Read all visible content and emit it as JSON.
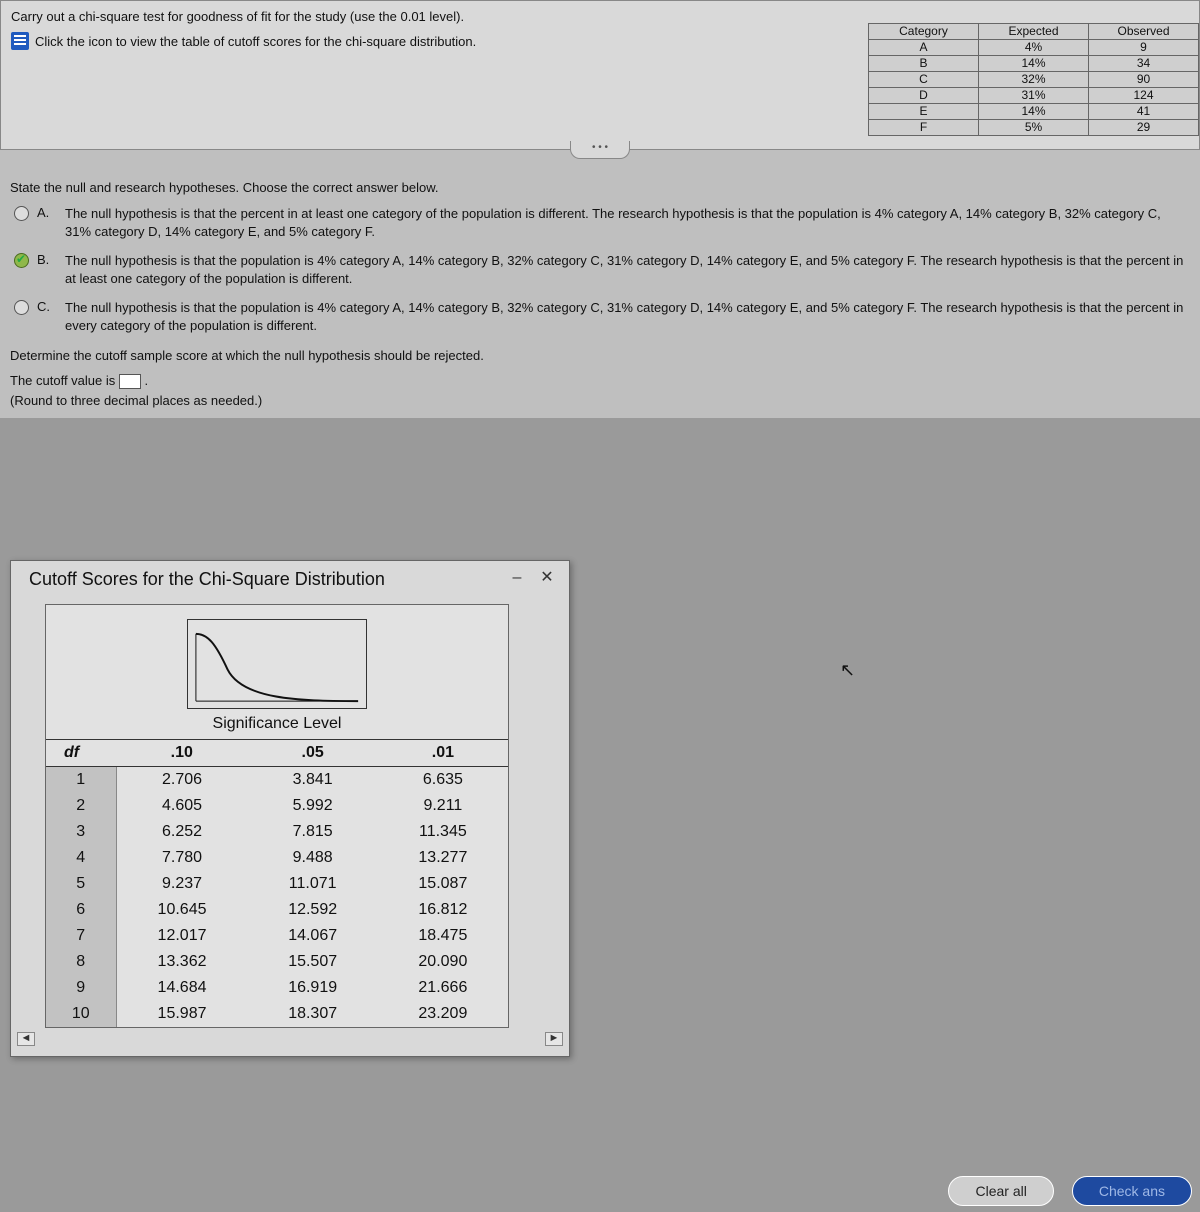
{
  "top": {
    "instruction": "Carry out a chi-square test for goodness of fit for the study (use the 0.01 level).",
    "link_text": "Click the icon to view the table of cutoff scores for the chi-square distribution.",
    "collapse": "• • •"
  },
  "dataTable": {
    "headers": [
      "Category",
      "Expected",
      "Observed"
    ],
    "rows": [
      [
        "A",
        "4%",
        "9"
      ],
      [
        "B",
        "14%",
        "34"
      ],
      [
        "C",
        "32%",
        "90"
      ],
      [
        "D",
        "31%",
        "124"
      ],
      [
        "E",
        "14%",
        "41"
      ],
      [
        "F",
        "5%",
        "29"
      ]
    ]
  },
  "question": {
    "prompt": "State the null and research hypotheses. Choose the correct answer below.",
    "options": [
      {
        "letter": "A.",
        "selected": false,
        "text": "The null hypothesis is that the percent in at least one category of the population is different. The research hypothesis is that the population is 4% category A, 14% category B, 32% category C, 31% category D, 14% category E, and 5% category F."
      },
      {
        "letter": "B.",
        "selected": true,
        "text": "The null hypothesis is that the population is 4% category A, 14% category B, 32% category C, 31% category D, 14% category E, and 5% category F. The research hypothesis is that the percent in at least one category of the population is different."
      },
      {
        "letter": "C.",
        "selected": false,
        "text": "The null hypothesis is that the population is 4% category A, 14% category B, 32% category C, 31% category D, 14% category E, and 5% category F. The research hypothesis is that the percent in every category of the population is different."
      }
    ],
    "determine": "Determine the cutoff sample score at which the null hypothesis should be rejected.",
    "cutoff_pre": "The cutoff value is ",
    "cutoff_post": ".",
    "round_note": "(Round to three decimal places as needed.)"
  },
  "popup": {
    "title": "Cutoff Scores for the Chi-Square Distribution",
    "sig_label": "Significance Level",
    "col_headers": [
      "df",
      ".10",
      ".05",
      ".01"
    ]
  },
  "chart_data": {
    "type": "table",
    "title": "Cutoff Scores for the Chi-Square Distribution",
    "xlabel": "Significance Level",
    "ylabel": "df",
    "columns": [
      "df",
      ".10",
      ".05",
      ".01"
    ],
    "rows": [
      [
        1,
        2.706,
        3.841,
        6.635
      ],
      [
        2,
        4.605,
        5.992,
        9.211
      ],
      [
        3,
        6.252,
        7.815,
        11.345
      ],
      [
        4,
        7.78,
        9.488,
        13.277
      ],
      [
        5,
        9.237,
        11.071,
        15.087
      ],
      [
        6,
        10.645,
        12.592,
        16.812
      ],
      [
        7,
        12.017,
        14.067,
        18.475
      ],
      [
        8,
        13.362,
        15.507,
        20.09
      ],
      [
        9,
        14.684,
        16.919,
        21.666
      ],
      [
        10,
        15.987,
        18.307,
        23.209
      ]
    ]
  },
  "buttons": {
    "clear": "Clear all",
    "check": "Check ans"
  }
}
